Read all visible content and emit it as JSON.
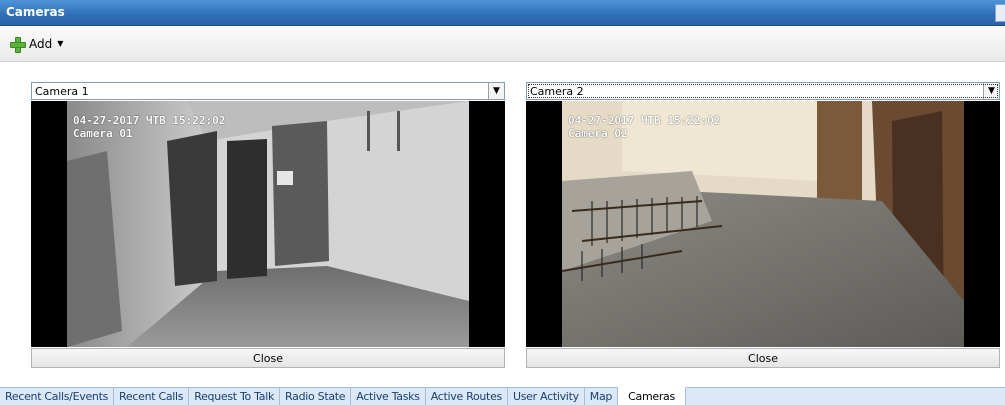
{
  "window": {
    "title": "Cameras"
  },
  "toolbar": {
    "add_label": "Add"
  },
  "cameras": [
    {
      "selected": "Camera 1",
      "osd_line1": "04-27-2017 ЧТВ 15:22:02",
      "osd_line2": "Camera 01",
      "close_label": "Close"
    },
    {
      "selected": "Camera 2",
      "osd_line1": "04-27-2017 ЧТВ 15:22:02",
      "osd_line2": "Camera 02",
      "close_label": "Close"
    }
  ],
  "tabs": [
    {
      "label": "Recent Calls/Events",
      "active": false
    },
    {
      "label": "Recent Calls",
      "active": false
    },
    {
      "label": "Request To Talk",
      "active": false
    },
    {
      "label": "Radio State",
      "active": false
    },
    {
      "label": "Active Tasks",
      "active": false
    },
    {
      "label": "Active Routes",
      "active": false
    },
    {
      "label": "User Activity",
      "active": false
    },
    {
      "label": "Map",
      "active": false
    },
    {
      "label": "Cameras",
      "active": true
    }
  ],
  "icons": {
    "add": "plus-icon",
    "add_menu": "chevron-down-icon",
    "dropdown": "dropdown-arrow-icon"
  }
}
